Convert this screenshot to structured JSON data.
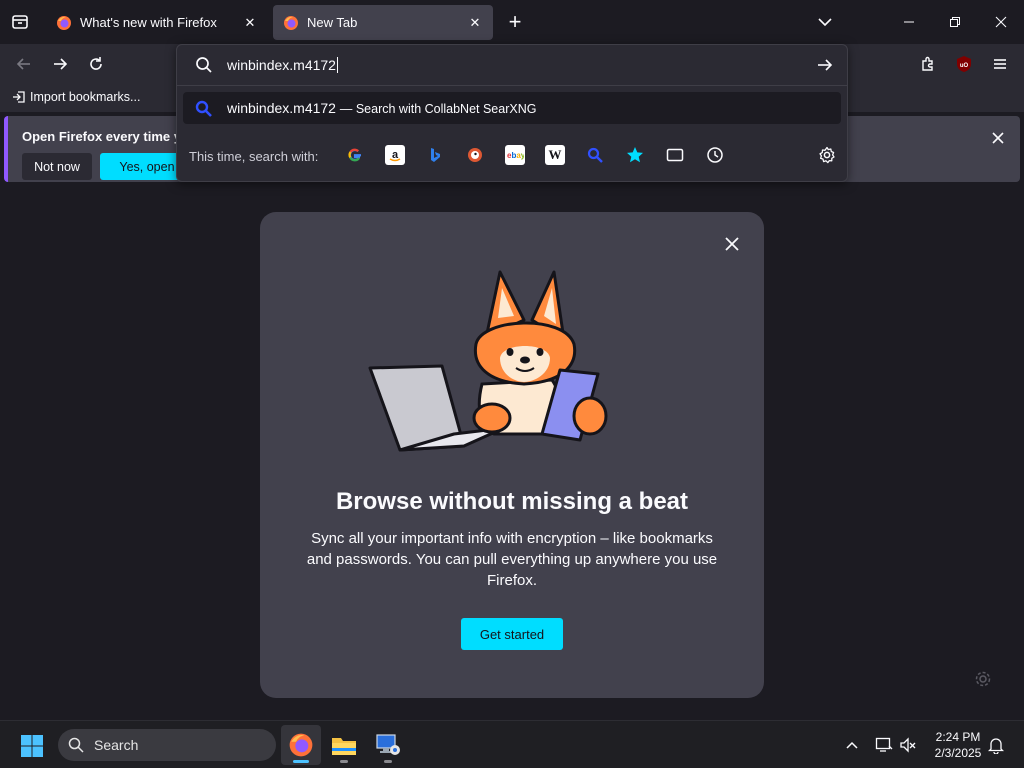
{
  "tabs": [
    {
      "title": "What's new with Firefox",
      "icon": "firefox-icon",
      "active": false
    },
    {
      "title": "New Tab",
      "icon": "firefox-icon",
      "active": true
    }
  ],
  "urlbar": {
    "value": "winbindex.m4172",
    "suggestion": {
      "text": "winbindex.m4172",
      "action": "— Search with CollabNet SearXNG"
    },
    "oneoff_label": "This time, search with:",
    "oneoffs": [
      "google-icon",
      "amazon-icon",
      "bing-icon",
      "duckduckgo-icon",
      "ebay-icon",
      "wikipedia-icon",
      "searxng-icon",
      "bookmarks-star-icon",
      "tabs-icon",
      "history-icon"
    ]
  },
  "bookmarks_bar": {
    "import_label": "Import bookmarks..."
  },
  "notification": {
    "text": "Open Firefox every time you",
    "not_now": "Not now",
    "yes": "Yes, open Fir"
  },
  "modal": {
    "title": "Browse without missing a beat",
    "body": "Sync all your important info with encryption – like bookmarks and passwords. You can pull everything up anywhere you use Firefox.",
    "cta": "Get started"
  },
  "taskbar": {
    "search_placeholder": "Search",
    "time": "2:24 PM",
    "date": "2/3/2025"
  },
  "colors": {
    "accent": "#00ddff",
    "tab_active": "#42414d",
    "toolbar": "#2b2a33",
    "background": "#1c1b22",
    "notification_accent": "#9059ff"
  }
}
